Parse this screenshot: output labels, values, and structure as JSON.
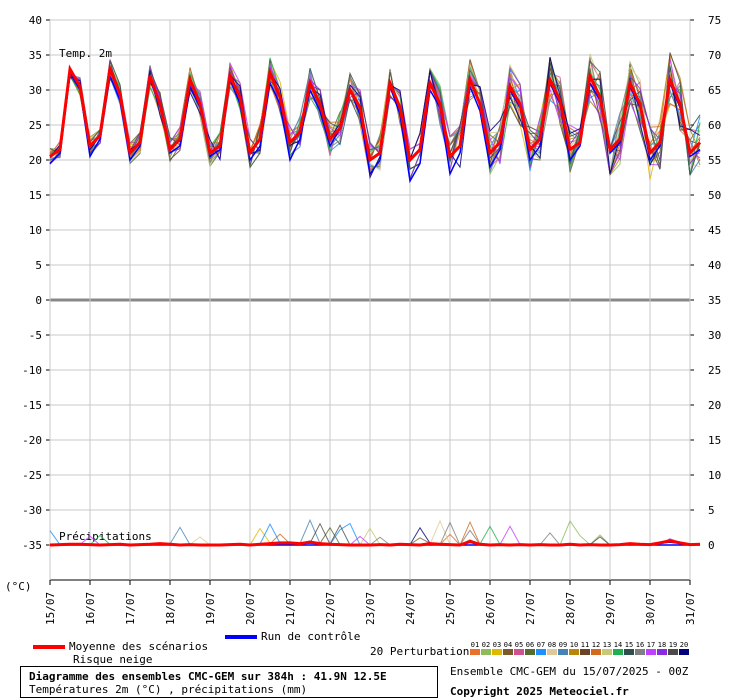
{
  "chart_data": {
    "type": "line",
    "title": "Diagramme des ensembles CMC-GEM sur 384h : 41.9N 12.5E",
    "subtitle": "Températures 2m (°C) , précipitations (mm)",
    "ylabel": "(°C)",
    "temp_label": "Temp. 2m",
    "precip_label": "Précipitations",
    "y_left_ticks": [
      "40",
      "35",
      "30",
      "25",
      "20",
      "15",
      "10",
      "5",
      "0",
      "-5",
      "-10",
      "-15",
      "-20",
      "-25",
      "-30",
      "-35"
    ],
    "y_right_top_ticks": [
      "75",
      "70",
      "65",
      "60",
      "55",
      "50",
      "45",
      "40",
      "35"
    ],
    "y_right_bottom_ticks": [
      "30",
      "25",
      "20",
      "15",
      "10",
      "5",
      "0"
    ],
    "ylim": [
      -40,
      40
    ],
    "x_dates": [
      "15/07",
      "16/07",
      "17/07",
      "18/07",
      "19/07",
      "20/07",
      "21/07",
      "22/07",
      "23/07",
      "24/07",
      "25/07",
      "26/07",
      "27/07",
      "28/07",
      "29/07",
      "30/07",
      "31/07"
    ],
    "x_steps_per_day": 4,
    "series": [
      {
        "name": "Moyenne des scénarios",
        "color": "#ff0000",
        "temperature": [
          20.5,
          21.5,
          33,
          30.5,
          22,
          23.5,
          33,
          29.5,
          21,
          22.5,
          32,
          28,
          21.5,
          23,
          31.5,
          28,
          21,
          22,
          32,
          29,
          21,
          23,
          32.5,
          29,
          22.5,
          24,
          31,
          28,
          23,
          24.5,
          30,
          27.5,
          20,
          21,
          31,
          27.5,
          20,
          21.5,
          31,
          28,
          20.5,
          22,
          31.5,
          28,
          21,
          22.5,
          30.5,
          28,
          21.5,
          23,
          31.5,
          28.5,
          21.5,
          22.5,
          32,
          29,
          21.5,
          23,
          31,
          28,
          21,
          22.5,
          31.5,
          28,
          21,
          22.5
        ],
        "precipitation": [
          0.0,
          0.05,
          0.1,
          0.1,
          0.05,
          0.0,
          0.05,
          0.1,
          0.0,
          0.05,
          0.1,
          0.2,
          0.1,
          0.0,
          0.05,
          0.0,
          0.0,
          0.0,
          0.05,
          0.1,
          0.0,
          0.1,
          0.2,
          0.3,
          0.3,
          0.2,
          0.4,
          0.2,
          0.1,
          0.05,
          0.0,
          0.0,
          0.0,
          0.05,
          0.0,
          0.1,
          0.05,
          0.0,
          0.2,
          0.1,
          0.05,
          0.0,
          0.5,
          0.1,
          0.0,
          0.05,
          0.0,
          0.05,
          0.0,
          0.05,
          0.0,
          0.0,
          0.1,
          0.0,
          0.05,
          0.0,
          0.0,
          0.05,
          0.2,
          0.1,
          0.05,
          0.3,
          0.6,
          0.3,
          0.05,
          0.1
        ]
      },
      {
        "name": "Run de contrôle",
        "color": "#0000ff",
        "temperature": [
          19.5,
          21,
          32.5,
          30,
          20.5,
          23,
          32,
          28.5,
          20,
          22,
          31.5,
          27.5,
          21,
          22,
          30.5,
          27.5,
          20.5,
          21.5,
          31.5,
          28,
          20,
          22,
          31,
          28,
          20,
          23,
          30,
          27,
          22,
          24.5,
          30,
          26.5,
          18,
          20,
          30.5,
          26.5,
          17,
          19.5,
          30,
          27.5,
          18,
          21,
          30.5,
          27,
          19,
          21.5,
          30,
          27.5,
          20,
          22,
          31,
          28,
          20,
          22,
          31,
          28.5,
          21,
          22.5,
          30.5,
          27.5,
          20,
          22,
          31,
          27.5,
          20.5,
          21.5
        ],
        "precipitation": [
          0,
          0,
          0,
          0,
          0,
          0,
          0,
          0,
          0,
          0,
          0,
          0,
          0,
          0,
          0,
          0,
          0,
          0,
          0,
          0,
          0,
          0,
          0,
          0,
          0,
          0,
          0,
          0,
          0,
          0,
          0,
          0,
          0,
          0,
          0,
          0,
          0,
          0,
          0,
          0,
          0,
          0,
          0,
          0,
          0,
          0,
          0,
          0,
          0,
          0,
          0,
          0,
          0,
          0,
          0,
          0,
          0,
          0,
          0,
          0,
          0,
          0,
          0,
          0,
          0,
          0
        ]
      }
    ],
    "perturbations": {
      "label": "20 Perturbations",
      "numbers": [
        "01",
        "02",
        "03",
        "04",
        "05",
        "06",
        "07",
        "08",
        "09",
        "10",
        "11",
        "12",
        "13",
        "14",
        "15",
        "16",
        "17",
        "18",
        "19",
        "20"
      ],
      "colors": [
        "#e8702a",
        "#8fbc5a",
        "#e0b800",
        "#7a5a2a",
        "#d05090",
        "#556b2f",
        "#1e90ff",
        "#e0c89a",
        "#4682b4",
        "#b8860b",
        "#6b4226",
        "#d2691e",
        "#c8c878",
        "#20b050",
        "#2f4f4f",
        "#808080",
        "#c040ff",
        "#8a2be2",
        "#4b4b4b",
        "#000080"
      ]
    },
    "snow_label": "Risque neige",
    "grid": true
  },
  "run_info": "Ensemble CMC-GEM du 15/07/2025 - 00Z",
  "copyright": "Copyright 2025 Meteociel.fr"
}
